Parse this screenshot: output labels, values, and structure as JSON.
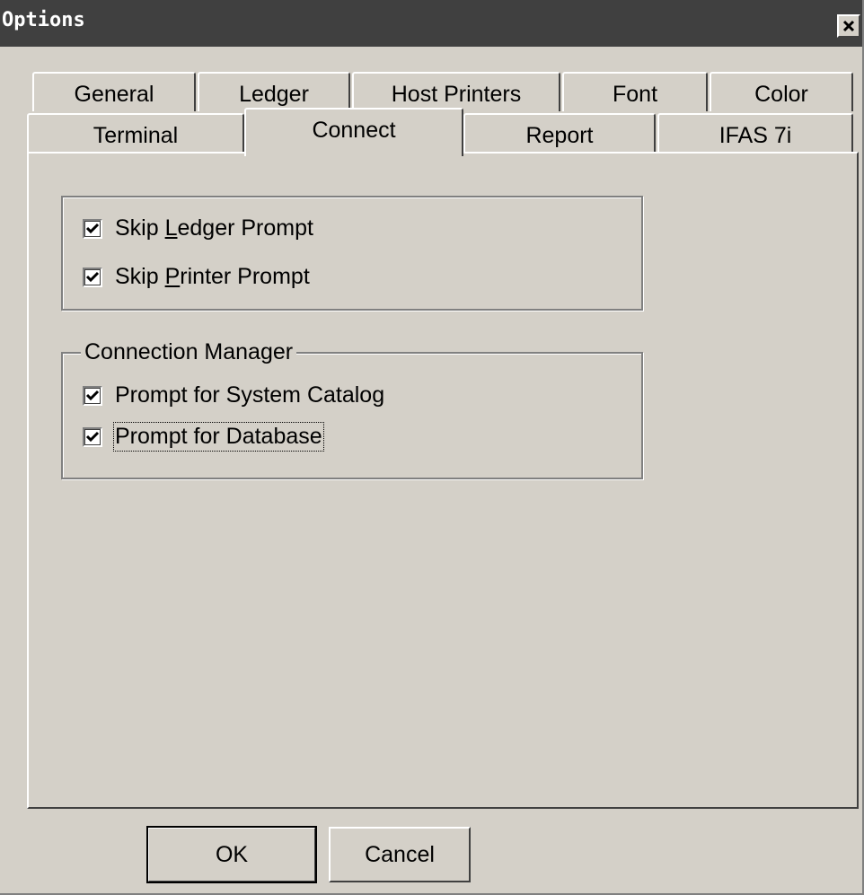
{
  "window": {
    "title": "Options",
    "close_icon": "close-x-icon"
  },
  "tabs_row_back": [
    {
      "label": "General"
    },
    {
      "label": "Ledger"
    },
    {
      "label": "Host Printers"
    },
    {
      "label": "Font"
    },
    {
      "label": "Color"
    }
  ],
  "tabs_row_front": [
    {
      "label": "Terminal"
    },
    {
      "label": "Connect",
      "active": true
    },
    {
      "label": "Report"
    },
    {
      "label": "IFAS 7i"
    }
  ],
  "prompts_group": {
    "skip_ledger": {
      "prefix": "Skip ",
      "mnemonic": "L",
      "suffix": "edger Prompt",
      "checked": true
    },
    "skip_printer": {
      "prefix": "Skip ",
      "mnemonic": "P",
      "suffix": "rinter Prompt",
      "checked": true
    }
  },
  "connection_group": {
    "legend": "Connection Manager",
    "system_catalog": {
      "label": "Prompt for System Catalog",
      "checked": true
    },
    "database": {
      "label": "Prompt for Database",
      "checked": true
    }
  },
  "buttons": {
    "ok": "OK",
    "cancel": "Cancel"
  },
  "colors": {
    "face": "#d4d0c8",
    "titlebar": "#404040",
    "title_text": "#ffffff"
  }
}
